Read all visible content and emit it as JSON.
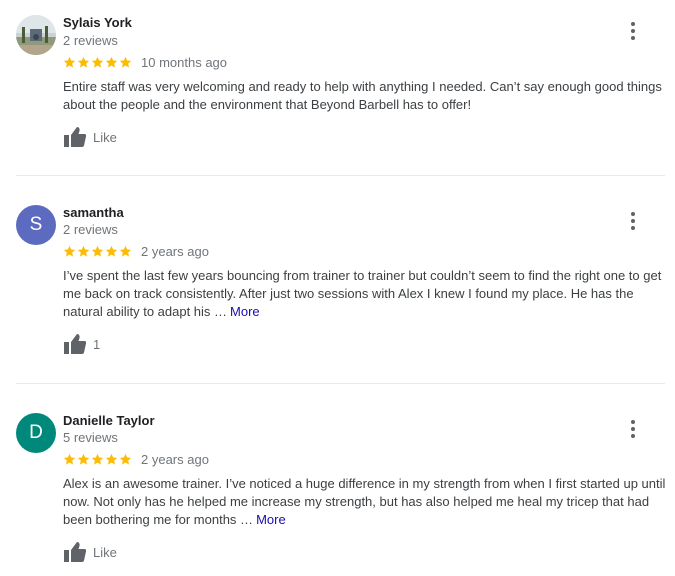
{
  "colors": {
    "star": "#fbbc04",
    "avatar_samantha": "#5c6bc0",
    "avatar_danielle": "#00897b",
    "link": "#1a0dab"
  },
  "icons": {
    "star": "star-icon",
    "menu": "more-vert-icon",
    "like": "thumb-up-icon"
  },
  "reviews": [
    {
      "name": "Sylais York",
      "count": "2 reviews",
      "rating": 5,
      "date": "10 months ago",
      "text": "Entire staff was very welcoming and ready to help with anything I needed. Can’t say enough good things about the people and the environment that Beyond Barbell has to offer!",
      "more": "",
      "like": "Like"
    },
    {
      "name": "samantha",
      "initial": "S",
      "count": "2 reviews",
      "rating": 5,
      "date": "2 years ago",
      "text": "I’ve spent the last few years bouncing from trainer to trainer but couldn’t seem to find the right one to get me back on track consistently. After just two sessions with Alex I knew I found my place.  He has the natural ability to adapt his …",
      "more": "More",
      "like": "1"
    },
    {
      "name": "Danielle Taylor",
      "initial": "D",
      "count": "5 reviews",
      "rating": 5,
      "date": "2 years ago",
      "text": "Alex is an awesome trainer. I’ve noticed a huge difference in my strength from when I first started up until now. Not only has he helped me increase my strength, but has also helped me heal my tricep that had been bothering me for months …",
      "more": "More",
      "like": "Like"
    }
  ]
}
